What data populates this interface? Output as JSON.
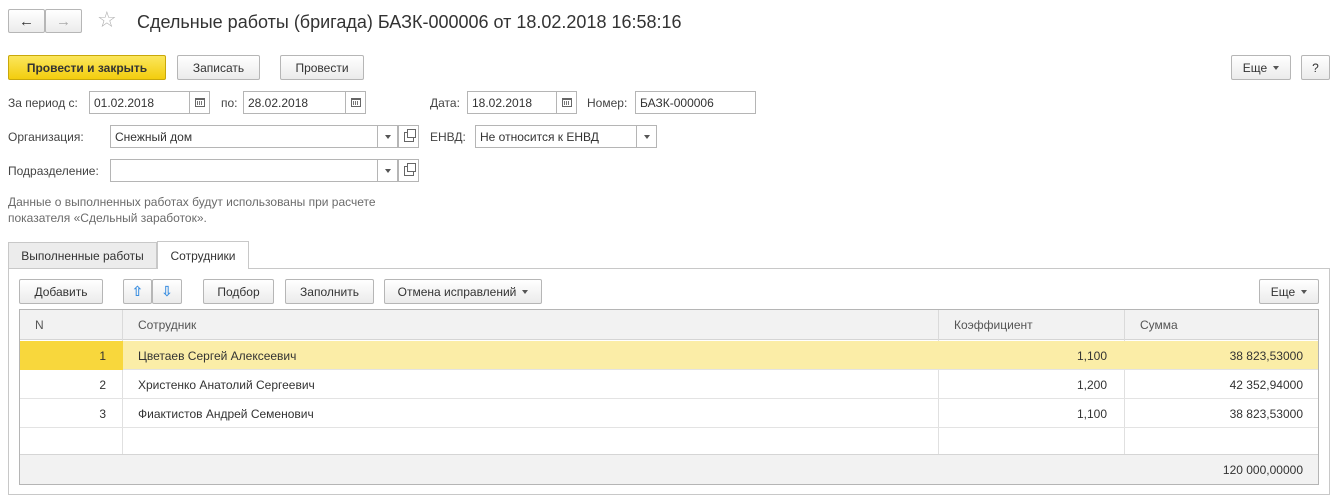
{
  "header": {
    "title": "Сдельные работы (бригада) БАЗК-000006 от 18.02.2018 16:58:16"
  },
  "toolbar": {
    "post_close": "Провести и закрыть",
    "save": "Записать",
    "post": "Провести",
    "more": "Еще",
    "help": "?"
  },
  "form": {
    "period_from_label": "За период с:",
    "period_from": "01.02.2018",
    "period_to_label": "по:",
    "period_to": "28.02.2018",
    "date_label": "Дата:",
    "date": "18.02.2018",
    "number_label": "Номер:",
    "number": "БАЗК-000006",
    "org_label": "Организация:",
    "org": "Снежный дом",
    "envd_label": "ЕНВД:",
    "envd": "Не относится к ЕНВД",
    "dept_label": "Подразделение:",
    "dept": "",
    "hint_line1": "Данные о выполненных работах будут использованы при расчете",
    "hint_line2": "показателя «Сдельный заработок»."
  },
  "tabs": [
    {
      "label": "Выполненные работы"
    },
    {
      "label": "Сотрудники"
    }
  ],
  "table_toolbar": {
    "add": "Добавить",
    "pick": "Подбор",
    "fill": "Заполнить",
    "cancel_corrections": "Отмена исправлений",
    "more": "Еще"
  },
  "table": {
    "columns": [
      "N",
      "Сотрудник",
      "Коэффициент",
      "Сумма"
    ],
    "rows": [
      {
        "n": "1",
        "employee": "Цветаев Сергей Алексеевич",
        "coef": "1,100",
        "sum": "38 823,53000"
      },
      {
        "n": "2",
        "employee": "Христенко Анатолий Сергеевич",
        "coef": "1,200",
        "sum": "42 352,94000"
      },
      {
        "n": "3",
        "employee": "Фиактистов Андрей Семенович",
        "coef": "1,100",
        "sum": "38 823,53000"
      }
    ],
    "total_sum": "120 000,00000"
  },
  "colors": {
    "primary_button": "#f3cd0e",
    "selected_row": "#fbeda7",
    "arrow_blue": "#3a8ee0"
  }
}
